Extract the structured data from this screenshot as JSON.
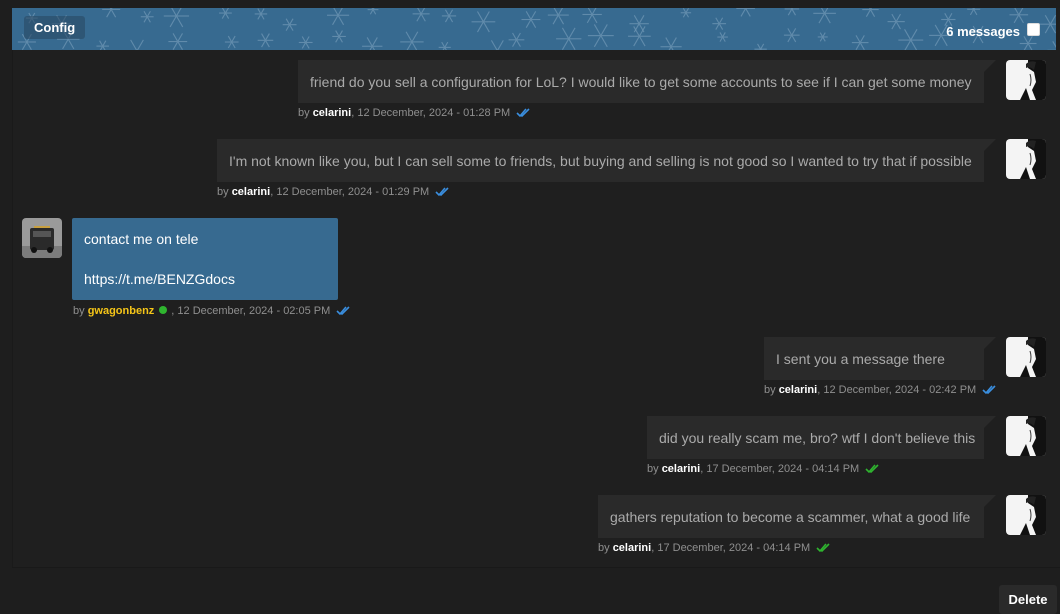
{
  "header": {
    "tab_label": "Config",
    "message_count": "6 messages",
    "colors": {
      "banner": "#376a90",
      "snowflake": "#6f97b5"
    }
  },
  "messages": [
    {
      "side": "right",
      "text": "friend do you sell a configuration for LoL? I would like to get some accounts to see if I can get some money",
      "by": "by",
      "user": "celarini",
      "timestamp": ", 12 December, 2024 - 01:28 PM",
      "read_status": "read",
      "check_color": "#3a8fe0",
      "avatar": "manga-girl-avatar"
    },
    {
      "side": "right",
      "text": "I'm not known like you, but I can sell some to friends, but buying and selling is not good so I wanted to try that if possible",
      "by": "by",
      "user": "celarini",
      "timestamp": ", 12 December, 2024 - 01:29 PM",
      "read_status": "read",
      "check_color": "#3a8fe0",
      "avatar": "manga-girl-avatar"
    },
    {
      "side": "left",
      "text": "contact me on tele\n\nhttps://t.me/BENZGdocs",
      "by": "by",
      "user": "gwagonbenz",
      "online": true,
      "timestamp": ", 12 December, 2024 - 02:05 PM",
      "read_status": "read",
      "check_color": "#3a8fe0",
      "avatar": "g-wagon-avatar"
    },
    {
      "side": "right",
      "text": "I sent you a message there",
      "by": "by",
      "user": "celarini",
      "timestamp": ", 12 December, 2024 - 02:42 PM",
      "read_status": "read",
      "check_color": "#3a8fe0",
      "avatar": "manga-girl-avatar"
    },
    {
      "side": "right",
      "text": "did you really scam me, bro? wtf I don't believe this",
      "by": "by",
      "user": "celarini",
      "timestamp": ", 17 December, 2024 - 04:14 PM",
      "read_status": "delivered",
      "check_color": "#2fb52f",
      "avatar": "manga-girl-avatar"
    },
    {
      "side": "right",
      "text": "gathers reputation to become a scammer, what a good life",
      "by": "by",
      "user": "celarini",
      "timestamp": ", 17 December, 2024 - 04:14 PM",
      "read_status": "delivered",
      "check_color": "#2fb52f",
      "avatar": "manga-girl-avatar"
    }
  ],
  "footer": {
    "delete_label": "Delete"
  }
}
